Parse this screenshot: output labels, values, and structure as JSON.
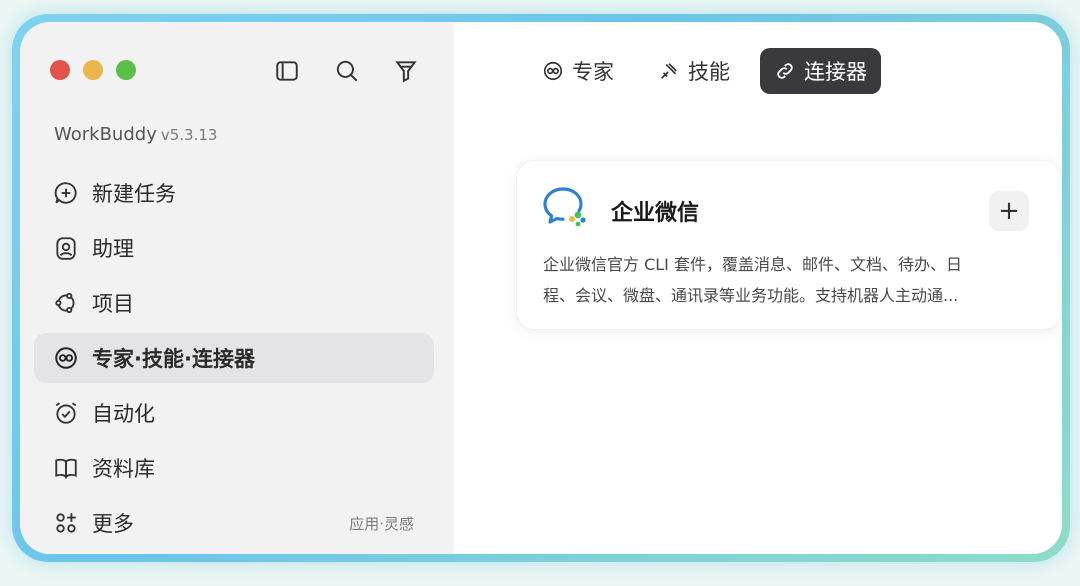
{
  "app": {
    "name": "WorkBuddy",
    "version": "v5.3.13"
  },
  "toolbar": {
    "icons": [
      "sidebar-toggle-icon",
      "search-icon",
      "filter-icon"
    ]
  },
  "sidebar": {
    "items": [
      {
        "label": "新建任务",
        "icon": "new-task-icon"
      },
      {
        "label": "助理",
        "icon": "assistant-icon"
      },
      {
        "label": "项目",
        "icon": "project-icon"
      },
      {
        "label": "专家·技能·连接器",
        "icon": "expert-icon",
        "active": true
      },
      {
        "label": "自动化",
        "icon": "alarm-clock-icon"
      },
      {
        "label": "资料库",
        "icon": "book-icon"
      },
      {
        "label": "更多",
        "icon": "apps-icon",
        "right": "应用·灵感"
      }
    ]
  },
  "tabs": [
    {
      "label": "专家",
      "icon": "expert-icon"
    },
    {
      "label": "技能",
      "icon": "skill-icon"
    },
    {
      "label": "连接器",
      "icon": "link-icon",
      "active": true
    }
  ],
  "connector": {
    "name": "企业微信",
    "description_line1": "企业微信官方 CLI 套件，覆盖消息、邮件、文档、待办、日",
    "description_line2": "程、会议、微盘、通讯录等业务功能。支持机器人主动通...",
    "add_label": "+",
    "colors": {
      "blue": "#2f7fd8",
      "green": "#3fc35a",
      "yellow": "#f2b83a"
    }
  }
}
